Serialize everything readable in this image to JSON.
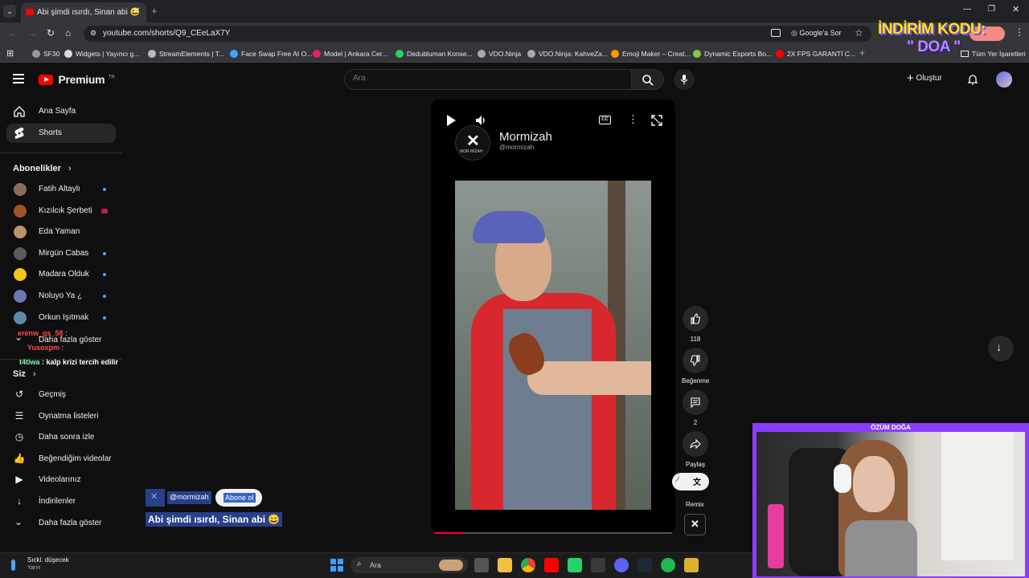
{
  "browser": {
    "tab_title": "Abi şimdi ısırdı, Sinan abi 😄",
    "url": "youtube.com/shorts/Q9_CEeLaX7Y",
    "google_sor": "Google'a Sor",
    "all_bookmarks": "Tüm Yer İşaretleri",
    "bookmarks": [
      "SF30",
      "Widgets | Yayıncı g...",
      "StreamElements | T...",
      "Face Swap Free AI O...",
      "Model | Ankara Cer...",
      "Dedubluman Konse...",
      "VDO.Ninja",
      "VDO.Ninja: KahveZa...",
      "Emoji Maker – Creat...",
      "Dynamic Esports Bo...",
      "2X FPS GARANTİ C..."
    ]
  },
  "youtube": {
    "logo_text": "Premium",
    "logo_sup": "TR",
    "search_placeholder": "Ara",
    "create_label": "Oluştur"
  },
  "sidebar": {
    "home": "Ana Sayfa",
    "shorts": "Shorts",
    "subs_title": "Abonelikler",
    "subscriptions": [
      "Fatih Altaylı",
      "Kızılcık Şerbeti",
      "Eda Yaman",
      "Mirgün Cabas",
      "Madara Olduk",
      "Noluyo Ya ¿",
      "Orkun Işıtmak"
    ],
    "show_more": "Daha fazla göster",
    "you_title": "Siz",
    "you_items": [
      "Geçmiş",
      "Oynatma listeleri",
      "Daha sonra izle",
      "Beğendiğim videolar",
      "Videolarınız",
      "İndirilenler"
    ],
    "show_more_2": "Daha fazla göster"
  },
  "short": {
    "channel_name": "Mormizah",
    "channel_handle": "@mormizah",
    "logo_caption": "MOR MİZAH",
    "subscribe": "Abone ol",
    "title": "Abi şimdi ısırdı, Sinan abi 😄",
    "progress": 0.12
  },
  "actions": {
    "likes": "118",
    "dislike": "Beğenme",
    "comments": "2",
    "share": "Paylaş",
    "remix": "Remix"
  },
  "overlay": {
    "promo_line1": "İNDİRİM KODU:",
    "promo_line2": "\" DOA \"",
    "cam_name": "ÖZÜM DOĞA",
    "chat": [
      {
        "user": "erenw_gs_58",
        "msg": ":",
        "color": "#ff4b4b"
      },
      {
        "user": "Yusoxpm",
        "msg": ":",
        "color": "#ff4b4b"
      },
      {
        "user": "t4tiwa",
        "msg": ": kalp krizi tercih edilir",
        "color": "#7fffb0"
      }
    ]
  },
  "taskbar": {
    "weather_title": "Sıckl. düşecek",
    "weather_sub": "Yarın",
    "search": "Ara"
  }
}
